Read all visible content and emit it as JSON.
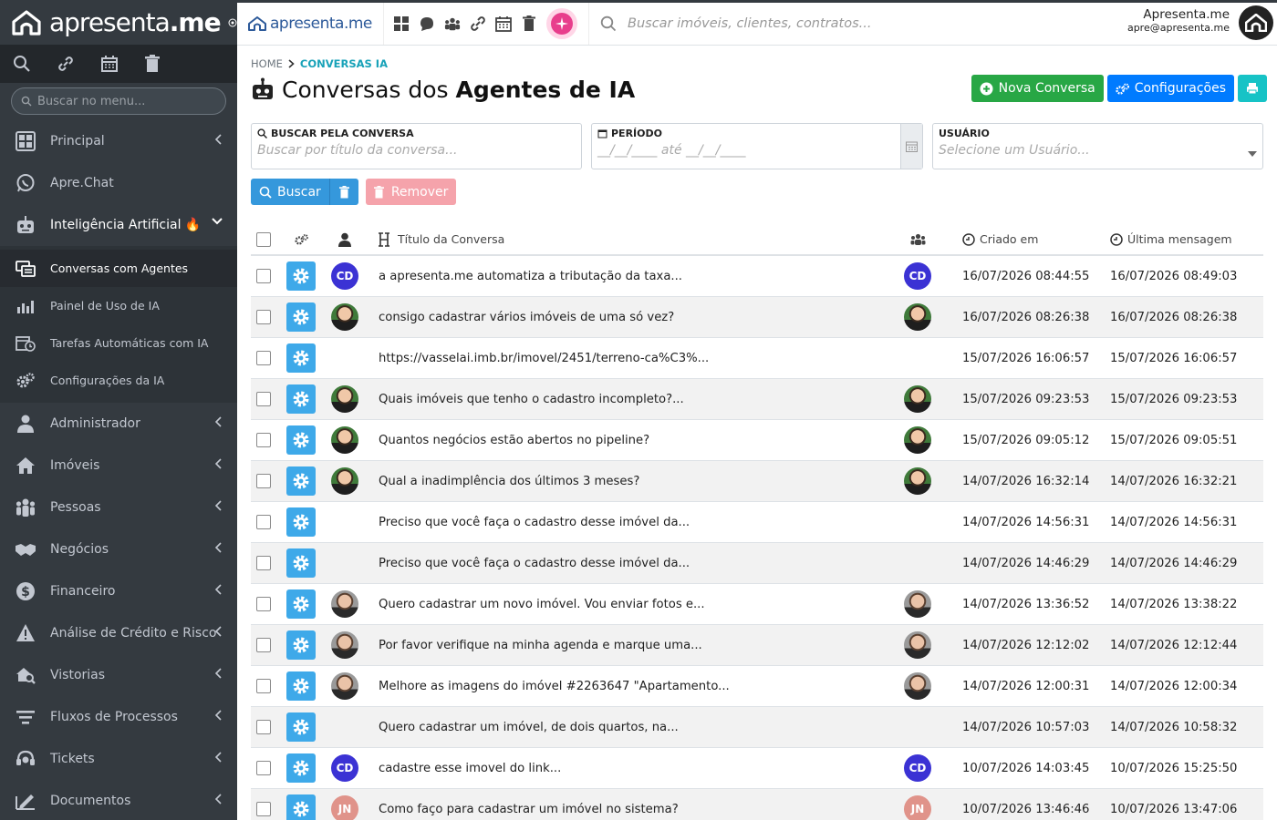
{
  "sidebar": {
    "brand_prefix": "apresenta",
    "brand_suffix": ".me",
    "search_placeholder": "Buscar no menu...",
    "items": [
      {
        "label": "Principal",
        "icon": "dashboard-icon"
      },
      {
        "label": "Apre.Chat",
        "icon": "whatsapp-icon"
      },
      {
        "label": "Inteligência Artificial 🔥",
        "icon": "robot-icon"
      },
      {
        "label": "Administrador",
        "icon": "user-icon"
      },
      {
        "label": "Imóveis",
        "icon": "home-icon"
      },
      {
        "label": "Pessoas",
        "icon": "people-icon"
      },
      {
        "label": "Negócios",
        "icon": "handshake-icon"
      },
      {
        "label": "Financeiro",
        "icon": "dollar-icon"
      },
      {
        "label": "Análise de Crédito e Risco",
        "icon": "warning-icon"
      },
      {
        "label": "Vistorias",
        "icon": "inspection-icon"
      },
      {
        "label": "Fluxos de Processos",
        "icon": "flow-icon"
      },
      {
        "label": "Tickets",
        "icon": "headset-icon"
      },
      {
        "label": "Documentos",
        "icon": "document-icon"
      }
    ],
    "subitems": [
      {
        "label": "Conversas com Agentes"
      },
      {
        "label": "Painel de Uso de IA"
      },
      {
        "label": "Tarefas Automáticas com IA"
      },
      {
        "label": "Configurações da IA"
      }
    ]
  },
  "topbar": {
    "logo_text": "apresenta.me",
    "search_placeholder": "Buscar imóveis, clientes, contratos...",
    "user_name": "Apresenta.me",
    "user_email": "apre@apresenta.me"
  },
  "breadcrumb": {
    "home": "HOME",
    "current": "CONVERSAS IA"
  },
  "page": {
    "title_prefix": "Conversas dos ",
    "title_bold": "Agentes de IA",
    "btn_new": "Nova Conversa",
    "btn_config": "Configurações"
  },
  "filters": {
    "search_label": "BUSCAR PELA CONVERSA",
    "search_placeholder": "Buscar por título da conversa...",
    "period_label": "PERÍODO",
    "period_placeholder": "__/__/____  até  __/__/____",
    "user_label": "USUÁRIO",
    "user_placeholder": "Selecione um Usuário...",
    "btn_search": "Buscar",
    "btn_remove": "Remover"
  },
  "table": {
    "col_title": "Título da Conversa",
    "col_created": "Criado em",
    "col_last": "Última mensagem",
    "rows": [
      {
        "avatar": "cd",
        "initials": "CD",
        "title": "a apresenta.me automatiza a tributação da taxa...",
        "created": "16/07/2026 08:44:55",
        "last": "16/07/2026 08:49:03"
      },
      {
        "avatar": "photo-g",
        "initials": "",
        "title": "consigo cadastrar vários imóveis de uma só vez?",
        "created": "16/07/2026 08:26:38",
        "last": "16/07/2026 08:26:38"
      },
      {
        "avatar": "none",
        "initials": "",
        "title": "https://vasselai.imb.br/imovel/2451/terreno-ca%C3%...",
        "created": "15/07/2026 16:06:57",
        "last": "15/07/2026 16:06:57"
      },
      {
        "avatar": "photo-g",
        "initials": "",
        "title": "Quais imóveis que tenho o cadastro incompleto?...",
        "created": "15/07/2026 09:23:53",
        "last": "15/07/2026 09:23:53"
      },
      {
        "avatar": "photo-g",
        "initials": "",
        "title": "Quantos negócios estão abertos no pipeline?",
        "created": "15/07/2026 09:05:12",
        "last": "15/07/2026 09:05:51"
      },
      {
        "avatar": "photo-g",
        "initials": "",
        "title": "Qual a inadimplência dos últimos 3 meses?",
        "created": "14/07/2026 16:32:14",
        "last": "14/07/2026 16:32:21"
      },
      {
        "avatar": "none",
        "initials": "",
        "title": "Preciso que você faça o cadastro desse imóvel da...",
        "created": "14/07/2026 14:56:31",
        "last": "14/07/2026 14:56:31"
      },
      {
        "avatar": "none",
        "initials": "",
        "title": "Preciso que você faça o cadastro desse imóvel da...",
        "created": "14/07/2026 14:46:29",
        "last": "14/07/2026 14:46:29"
      },
      {
        "avatar": "photo-b",
        "initials": "",
        "title": "Quero cadastrar um novo imóvel. Vou enviar fotos e...",
        "created": "14/07/2026 13:36:52",
        "last": "14/07/2026 13:38:22"
      },
      {
        "avatar": "photo-b",
        "initials": "",
        "title": "Por favor verifique na minha agenda e marque uma...",
        "created": "14/07/2026 12:12:02",
        "last": "14/07/2026 12:12:44"
      },
      {
        "avatar": "photo-b",
        "initials": "",
        "title": "Melhore as imagens do imóvel #2263647 \"Apartamento...",
        "created": "14/07/2026 12:00:31",
        "last": "14/07/2026 12:00:34"
      },
      {
        "avatar": "none",
        "initials": "",
        "title": "Quero cadastrar um imóvel, de dois quartos, na...",
        "created": "14/07/2026 10:57:03",
        "last": "14/07/2026 10:58:32"
      },
      {
        "avatar": "cd",
        "initials": "CD",
        "title": "cadastre esse imovel do link...",
        "created": "10/07/2026 14:03:45",
        "last": "10/07/2026 15:25:50"
      },
      {
        "avatar": "jn",
        "initials": "JN",
        "title": "Como faço para cadastrar um imóvel no sistema?",
        "created": "10/07/2026 13:46:46",
        "last": "10/07/2026 13:47:06"
      }
    ]
  },
  "colors": {
    "sidebar": "#343a40",
    "accent": "#17a2b8",
    "green": "#28a745",
    "blue": "#007bff",
    "gear": "#3ea9e9"
  }
}
